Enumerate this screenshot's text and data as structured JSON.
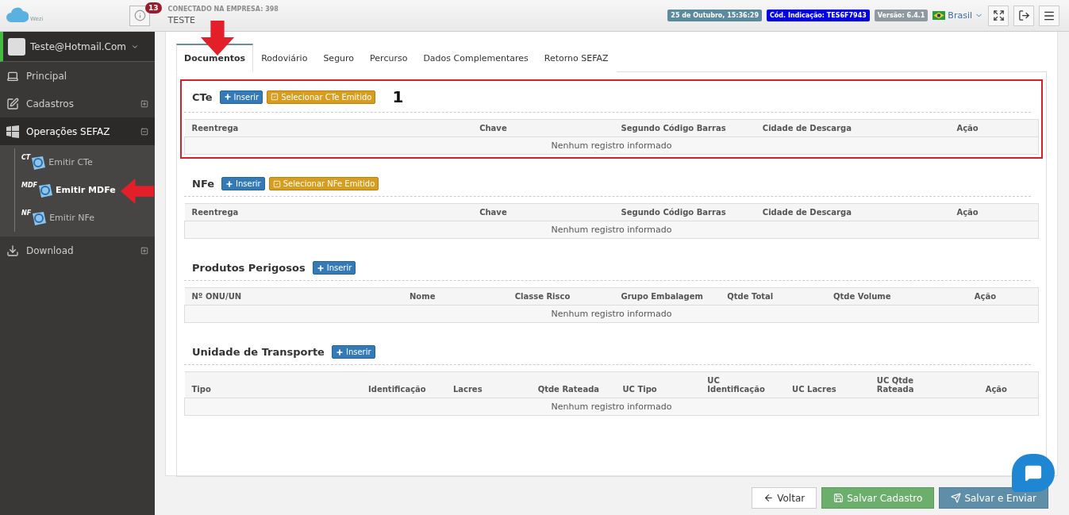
{
  "header": {
    "logo_text": "Wezi",
    "notifications": "13",
    "company_label": "CONECTADO NA EMPRESA: 398",
    "company_name": "TESTE",
    "badges": [
      {
        "label": "25 de Outubro, 15:36:29",
        "color": "#5a8a9b"
      },
      {
        "label": "Cód. Indicação: TES6F7943",
        "color": "#0000e0"
      },
      {
        "label": "Versão: 6.4.1",
        "color": "#8f9aa0"
      }
    ],
    "language": "Brasil"
  },
  "sidebar": {
    "user": "Teste@Hotmail.Com",
    "items": [
      {
        "label": "Principal",
        "kind": "link",
        "selected": false
      },
      {
        "label": "Cadastros",
        "kind": "group",
        "expanded": false,
        "selected": false
      },
      {
        "label": "Operações SEFAZ",
        "kind": "group",
        "expanded": true,
        "selected": true,
        "children": [
          {
            "label": "Emitir CTe",
            "badge": "CT",
            "selected": false
          },
          {
            "label": "Emitir MDFe",
            "badge": "MDF",
            "selected": true
          },
          {
            "label": "Emitir NFe",
            "badge": "NF",
            "selected": false
          }
        ]
      },
      {
        "label": "Download",
        "kind": "group",
        "expanded": false,
        "selected": false
      }
    ]
  },
  "tabs": [
    {
      "label": "Documentos",
      "selected": true
    },
    {
      "label": "Rodoviário",
      "selected": false
    },
    {
      "label": "Seguro",
      "selected": false
    },
    {
      "label": "Percurso",
      "selected": false
    },
    {
      "label": "Dados Complementares",
      "selected": false
    },
    {
      "label": "Retorno SEFAZ",
      "selected": false
    }
  ],
  "sections": [
    {
      "title": "CTe",
      "highlighted": true,
      "annotation": "1",
      "buttons": [
        {
          "label": "Inserir",
          "kind": "insert"
        },
        {
          "label": "Selecionar CTe Emitido",
          "kind": "select"
        }
      ],
      "columns": [
        "Reentrega",
        "Chave",
        "Segundo Código Barras",
        "Cidade de Descarga",
        "Ação"
      ],
      "empty": "Nenhum registro informado"
    },
    {
      "title": "NFe",
      "highlighted": false,
      "buttons": [
        {
          "label": "Inserir",
          "kind": "insert"
        },
        {
          "label": "Selecionar NFe Emitido",
          "kind": "select"
        }
      ],
      "columns": [
        "Reentrega",
        "Chave",
        "Segundo Código Barras",
        "Cidade de Descarga",
        "Ação"
      ],
      "empty": "Nenhum registro informado"
    },
    {
      "title": "Produtos Perigosos",
      "highlighted": false,
      "buttons": [
        {
          "label": "Inserir",
          "kind": "insert"
        }
      ],
      "columns": [
        "Nº ONU/UN",
        "Nome",
        "Classe Risco",
        "Grupo Embalagem",
        "Qtde Total",
        "Qtde Volume",
        "Ação"
      ],
      "empty": "Nenhum registro informado"
    },
    {
      "title": "Unidade de Transporte",
      "highlighted": false,
      "buttons": [
        {
          "label": "Inserir",
          "kind": "insert"
        }
      ],
      "columns": [
        "Tipo",
        "Identificação",
        "Lacres",
        "Qtde Rateada",
        "UC Tipo",
        "UC Identificação",
        "UC Lacres",
        "UC Qtde Rateada",
        "Ação"
      ],
      "empty": "Nenhum registro informado"
    }
  ],
  "footer_buttons": [
    {
      "label": "Voltar",
      "kind": "back"
    },
    {
      "label": "Salvar Cadastro",
      "kind": "save"
    },
    {
      "label": "Salvar e Enviar",
      "kind": "send"
    }
  ]
}
